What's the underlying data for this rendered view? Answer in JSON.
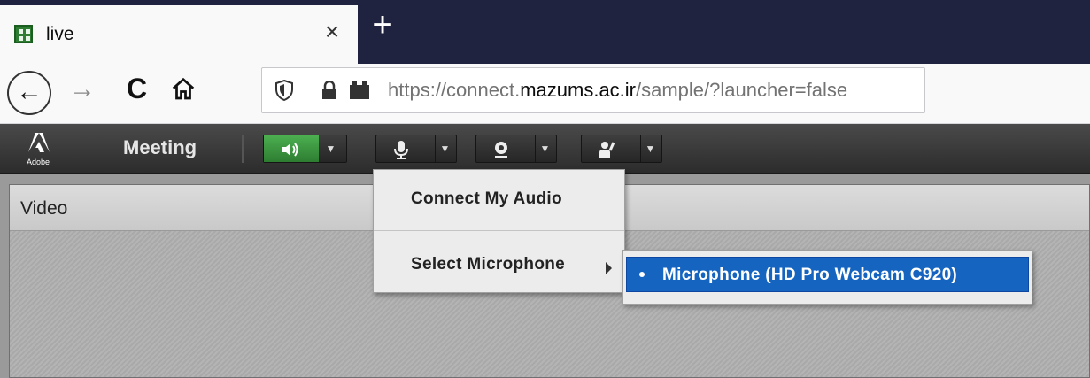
{
  "browser": {
    "tab": {
      "title": "live",
      "close_glyph": "×"
    },
    "new_tab_glyph": "+",
    "nav": {
      "back_glyph": "←",
      "forward_glyph": "→",
      "reload_glyph": "C"
    },
    "url": {
      "prefix": "https://connect.",
      "domain": "mazums.ac.ir",
      "path": "/sample/?launcher=false"
    }
  },
  "app": {
    "logo_text": "Adobe",
    "meeting_menu": "Meeting",
    "pod_title": "Video",
    "speaker_active_color": "#43a047"
  },
  "audio_menu": {
    "items": [
      {
        "label": "Connect My Audio"
      },
      {
        "label": "Select Microphone"
      }
    ],
    "submenu": {
      "selected_item": "Microphone (HD Pro Webcam C920)",
      "highlight_color": "#1565c0"
    }
  }
}
